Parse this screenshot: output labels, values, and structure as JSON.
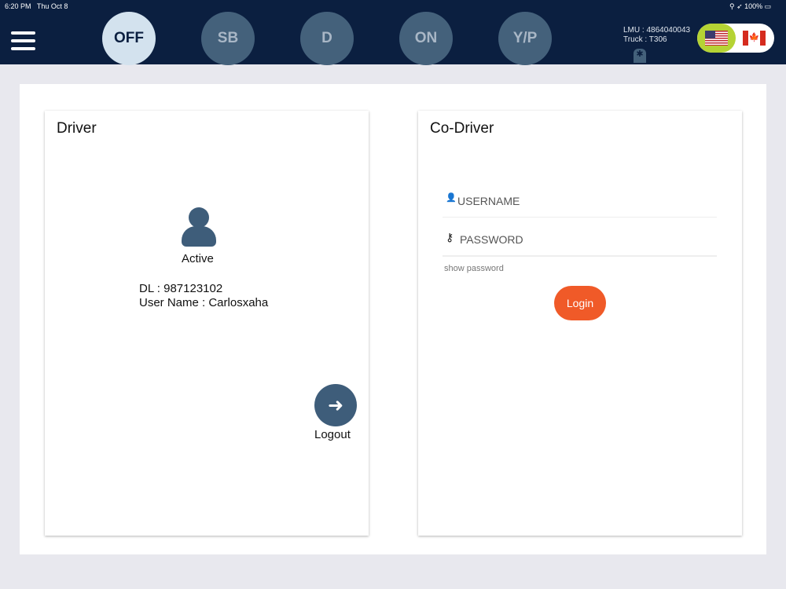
{
  "status_bar": {
    "time": "6:20 PM",
    "date": "Thu Oct 8",
    "battery": "100%"
  },
  "duty_status": [
    {
      "label": "OFF",
      "active": true
    },
    {
      "label": "SB",
      "active": false
    },
    {
      "label": "D",
      "active": false
    },
    {
      "label": "ON",
      "active": false
    },
    {
      "label": "Y/P",
      "active": false
    }
  ],
  "device": {
    "lmu": "LMU : 4864040043",
    "truck": "Truck : T306"
  },
  "flag_ca_symbol": "🍁",
  "driver": {
    "title": "Driver",
    "status": "Active",
    "dl": "DL : 987123102",
    "username": "User Name : Carlosxaha",
    "logout_label": "Logout",
    "logout_icon": "➜"
  },
  "codriver": {
    "title": "Co-Driver",
    "username_placeholder": "USERNAME",
    "password_placeholder": "PASSWORD",
    "show_password": "show password",
    "login_label": "Login"
  }
}
